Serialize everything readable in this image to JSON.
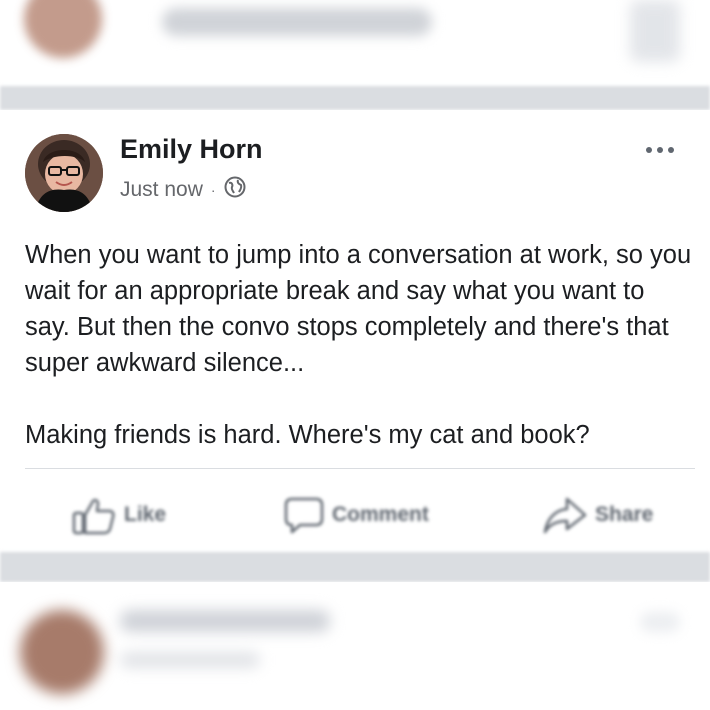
{
  "post": {
    "author": "Emily Horn",
    "timestamp": "Just now",
    "separator": "·",
    "privacy_icon": "globe-icon",
    "more_icon": "ellipsis-icon",
    "body": "When you want to jump into a conversation at work, so you wait for an appropriate break and say what you want to say. But then the convo stops completely and there's that super awkward silence...\n\nMaking friends is hard. Where's my cat and book?",
    "actions": {
      "like": "Like",
      "comment": "Comment",
      "share": "Share"
    }
  },
  "colors": {
    "text": "#1c1e21",
    "secondary": "#65676b",
    "divider": "#dadde1"
  }
}
